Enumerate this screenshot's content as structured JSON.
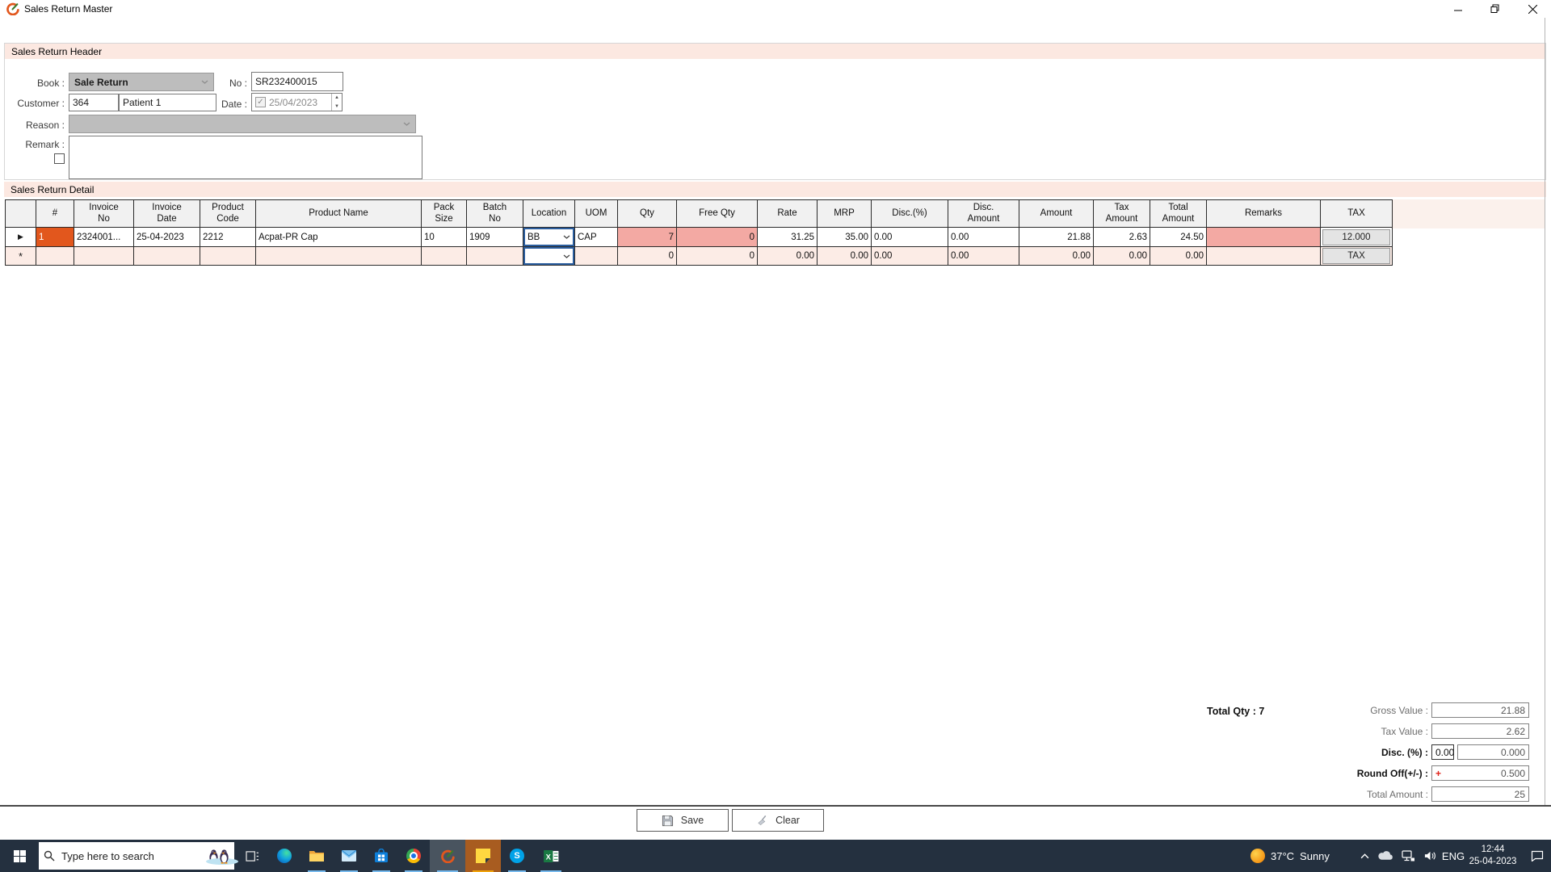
{
  "window": {
    "title": "Sales Return Master"
  },
  "header": {
    "section_title": "Sales Return Header",
    "book_label": "Book :",
    "book_value": "Sale Return",
    "no_label": "No :",
    "no_value": "SR232400015",
    "customer_label": "Customer :",
    "customer_code": "364",
    "customer_name": "Patient 1",
    "date_label": "Date :",
    "date_value": "25/04/2023",
    "date_check": "✓",
    "reason_label": "Reason :",
    "reason_value": "",
    "remark_label": "Remark :",
    "remark_value": ""
  },
  "detail": {
    "section_title": "Sales Return Detail",
    "columns": [
      "",
      "#",
      "Invoice\nNo",
      "Invoice\nDate",
      "Product\nCode",
      "Product Name",
      "Pack\nSize",
      "Batch\nNo",
      "Location",
      "UOM",
      "Qty",
      "Free Qty",
      "Rate",
      "MRP",
      "Disc.(%)",
      "Disc.\nAmount",
      "Amount",
      "Tax\nAmount",
      "Total\nAmount",
      "Remarks",
      "TAX"
    ],
    "row1": {
      "selector": "▶",
      "num": "1",
      "invoice_no": "2324001...",
      "invoice_date": "25-04-2023",
      "product_code": "2212",
      "product_name": "Acpat-PR Cap",
      "pack_size": "10",
      "batch_no": "1909",
      "location": "BB",
      "uom": "CAP",
      "qty": "7",
      "free_qty": "0",
      "rate": "31.25",
      "mrp": "35.00",
      "disc_pct": "0.00",
      "disc_amount": "0.00",
      "amount": "21.88",
      "tax_amount": "2.63",
      "total_amount": "24.50",
      "remarks": "",
      "tax_button": "12.000"
    },
    "row2": {
      "selector": "*",
      "num": "",
      "invoice_no": "",
      "invoice_date": "",
      "product_code": "",
      "product_name": "",
      "pack_size": "",
      "batch_no": "",
      "location": "",
      "uom": "",
      "qty": "0",
      "free_qty": "0",
      "rate": "0.00",
      "mrp": "0.00",
      "disc_pct": "0.00",
      "disc_amount": "0.00",
      "amount": "0.00",
      "tax_amount": "0.00",
      "total_amount": "0.00",
      "remarks": "",
      "tax_button": "TAX"
    }
  },
  "summary": {
    "total_qty": "Total Qty : 7",
    "gross_value_label": "Gross Value :",
    "gross_value": "21.88",
    "tax_value_label": "Tax Value :",
    "tax_value": "2.62",
    "disc_label": "Disc. (%) :",
    "disc_pct": "0.00",
    "disc_amount": "0.000",
    "round_off_label": "Round Off(+/-) :",
    "round_off_sign": "+",
    "round_off_value": "0.500",
    "total_amount_label": "Total Amount :",
    "total_amount": "25"
  },
  "actions": {
    "save": "Save",
    "clear": "Clear"
  },
  "taskbar": {
    "search_placeholder": "Type here to search",
    "weather_temp": "37°C",
    "weather_condition": "Sunny",
    "language": "ENG",
    "time": "12:44",
    "date": "25-04-2023"
  },
  "colors": {
    "accent_orange": "#e2571d",
    "pink_strip": "#fce8e1",
    "salmon_cell": "#f3a9a3",
    "taskbar": "#24303f",
    "focus_blue": "#2a5d9e"
  }
}
